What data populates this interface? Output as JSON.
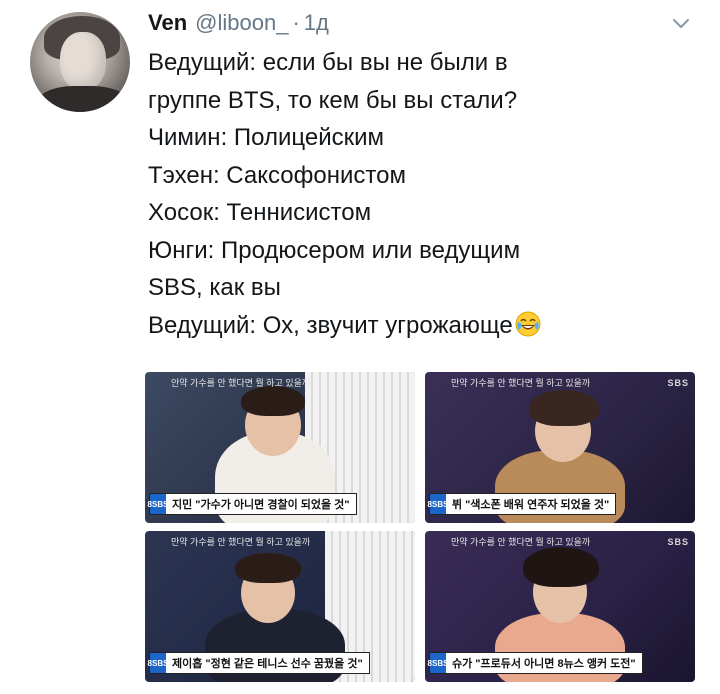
{
  "tweet": {
    "author_name": "Ven",
    "handle": "@liboon_",
    "separator": "·",
    "time": "1д",
    "lines": [
      "Ведущий: если бы вы не были в",
      "группе BTS, то кем бы вы стали?",
      "Чимин: Полицейским",
      "Тэхен: Саксофонистом",
      "Хосок: Теннисистом",
      "Юнги: Продюсером или ведущим",
      "SBS, как вы",
      "Ведущий: Ох, звучит угрожающе"
    ],
    "emoji": "face-with-tears-of-joy-icon"
  },
  "media": {
    "panels": [
      {
        "top_caption": "안약 가수를 안 했다면 뭘 하고 있을까",
        "logo_text": "8SBS",
        "caption": "지민 \"가수가 아니면 경찰이 되었을 것\""
      },
      {
        "top_caption": "만약 가수를 안 했다면 뭘 하고 있을까",
        "watermark": "SBS",
        "logo_text": "8SBS",
        "caption": "뷔 \"색소폰 배워 연주자 되었을 것\""
      },
      {
        "top_caption": "만약 가수를 안 했다면 뭘 하고 있을까",
        "logo_text": "8SBS",
        "caption": "제이홉 \"정현 같은 테니스 선수 꿈꿨을 것\""
      },
      {
        "top_caption": "만약 가수를 안 했다면 뭘 하고 있을까",
        "watermark": "SBS",
        "logo_text": "8SBS",
        "caption": "슈가 \"프로듀서 아니면 8뉴스 앵커 도전\""
      }
    ]
  }
}
